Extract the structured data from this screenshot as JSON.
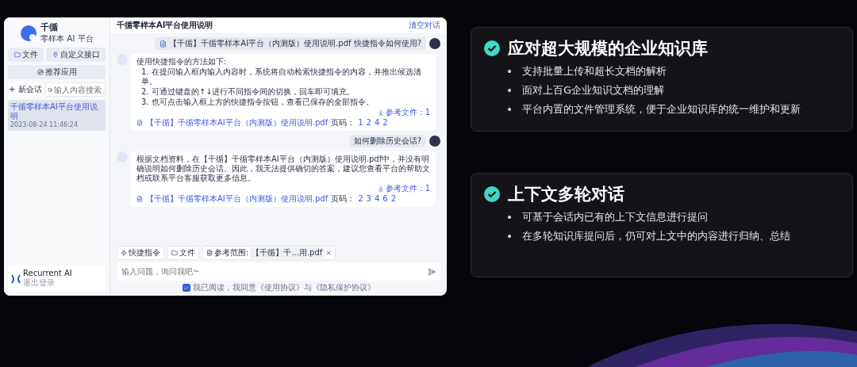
{
  "app": {
    "brand": {
      "name": "千循",
      "tagline": "零样本 AI 平台"
    },
    "sidebar": {
      "buttons": [
        {
          "label": "文件"
        },
        {
          "label": "自定义接口"
        }
      ],
      "recommend": "推荐应用",
      "new_chat": "+ 新会话",
      "search": {
        "placeholder": "输入内容搜索"
      },
      "sessions": [
        {
          "title": "千循零样本AI平台使用说明",
          "time": "2023-08-24 11:46:24",
          "selected": true
        }
      ],
      "account": {
        "name": "Recurrent AI",
        "sub": "退出登录"
      }
    },
    "header": {
      "title": "千循零样本AI平台使用说明",
      "action": "清空对话"
    },
    "messages": [
      {
        "kind": "user",
        "text": "【千循】千循零样本AI平台（内测版）使用说明.pdf 快捷指令如何使用?",
        "file": true
      },
      {
        "kind": "ai",
        "intro": "使用快捷指令的方法如下:",
        "items": [
          "1. 在提问输入框内输入内容时，系统将自动检索快捷指令的内容，并推出候选清单。",
          "2. 可通过键盘的↑↓进行不同指令间的切换，回车即可填充。",
          "3. 也可点击输入框上方的快捷指令按钮，查看已保存的全部指令。"
        ],
        "refs": "参考文件：1",
        "source": "【千循】千循零样本AI平台（内测版）使用说明.pdf",
        "page_label": "页码：",
        "pages": [
          "1",
          "2",
          "4",
          "2"
        ]
      },
      {
        "kind": "user",
        "text": "如何删除历史会话?",
        "file": false
      },
      {
        "kind": "ai",
        "intro": "根据文档资料，在【千循】千循零样本AI平台（内测版）使用说明.pdf中，并没有明确说明如何删除历史会话。因此，我无法提供确切的答案，建议您查看平台的帮助文档或联系平台客服获取更多信息。",
        "refs": "参考文件：1",
        "source": "【千循】千循零样本AI平台（内测版）使用说明.pdf",
        "page_label": "页码：",
        "pages": [
          "2",
          "3",
          "4",
          "6",
          "2"
        ]
      }
    ],
    "toolbar": {
      "shortcut": "快捷指令",
      "file": "文件",
      "scope_label": "参考范围:",
      "scope_value": "【千循】千...用.pdf"
    },
    "input": {
      "placeholder": "输入问题，询问我吧~"
    },
    "agreement": {
      "checked": true,
      "text": "我已阅读，我同意《使用协议》与《隐私保护协议》"
    }
  },
  "features": [
    {
      "title": "应对超大规模的企业知识库",
      "points": [
        "支持批量上传和超长文档的解析",
        "面对上百G企业知识文档的理解",
        "平台内置的文件管理系统，便于企业知识库的统一维护和更新"
      ]
    },
    {
      "title": "上下文多轮对话",
      "points": [
        "可基于会话内已有的上下文信息进行提问",
        "在多轮知识库提问后，仍可对上文中的内容进行归纳、总结"
      ]
    }
  ]
}
